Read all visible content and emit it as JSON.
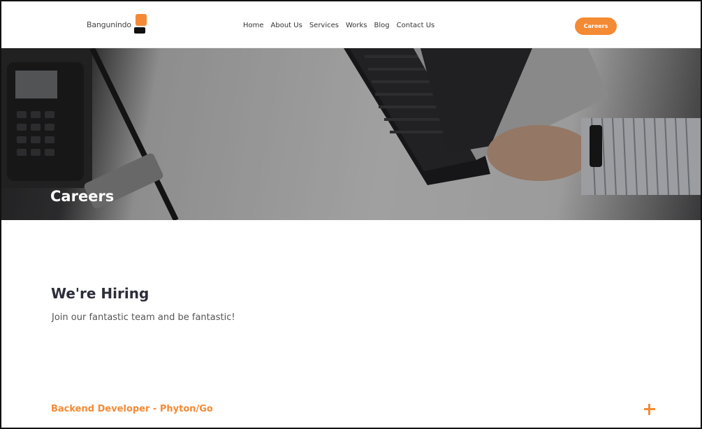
{
  "header": {
    "logo_text": "Bangunindo",
    "nav": [
      "Home",
      "About Us",
      "Services",
      "Works",
      "Blog",
      "Contact Us"
    ],
    "cta_label": "Careers"
  },
  "hero": {
    "title": "Careers"
  },
  "content": {
    "heading": "We're Hiring",
    "subheading": "Join our fantastic team and be fantastic!",
    "jobs": [
      {
        "title": "Backend Developer - Phyton/Go"
      }
    ]
  },
  "colors": {
    "accent": "#f58a34",
    "heading": "#2d2d3a"
  },
  "icons": [
    "logo-mark-icon",
    "plus-icon"
  ]
}
